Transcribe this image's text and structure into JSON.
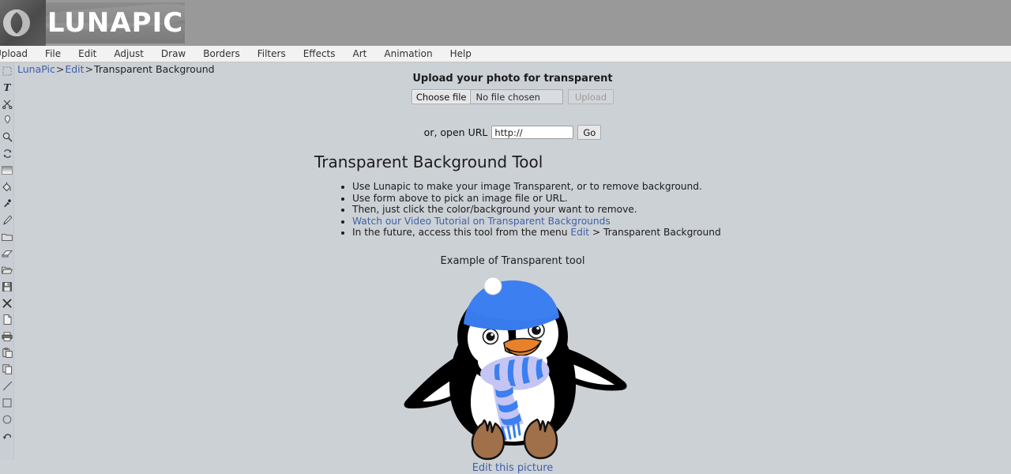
{
  "header": {
    "logo_text": "LUNAPIC",
    "logo_icon": "crescent-moon-icon"
  },
  "menubar": {
    "items": [
      {
        "label": "Upload"
      },
      {
        "label": "File"
      },
      {
        "label": "Edit"
      },
      {
        "label": "Adjust"
      },
      {
        "label": "Draw"
      },
      {
        "label": "Borders"
      },
      {
        "label": "Filters"
      },
      {
        "label": "Effects"
      },
      {
        "label": "Art"
      },
      {
        "label": "Animation"
      },
      {
        "label": "Help"
      }
    ]
  },
  "breadcrumb": {
    "home": "LunaPic",
    "sep1": ">",
    "section": "Edit",
    "sep2": ">",
    "current": "Transparent Background"
  },
  "sidebar": {
    "tools": [
      {
        "name": "marquee-select-icon",
        "title": "Select"
      },
      {
        "name": "text-icon",
        "title": "Text"
      },
      {
        "name": "scissors-icon",
        "title": "Cut"
      },
      {
        "name": "eraser-small-icon",
        "title": "Erase"
      },
      {
        "name": "magnifier-icon",
        "title": "Zoom"
      },
      {
        "name": "rotate-refresh-icon",
        "title": "Rotate"
      },
      {
        "name": "gradient-bar-icon",
        "title": "Gradient"
      },
      {
        "name": "paint-bucket-icon",
        "title": "Fill"
      },
      {
        "name": "eyedropper-icon",
        "title": "Color Picker"
      },
      {
        "name": "pencil-icon",
        "title": "Pencil"
      },
      {
        "name": "folder-icon",
        "title": "Folder"
      },
      {
        "name": "eraser-icon",
        "title": "Eraser"
      },
      {
        "name": "open-folder-icon",
        "title": "Open"
      },
      {
        "name": "save-floppy-icon",
        "title": "Save"
      },
      {
        "name": "close-x-icon",
        "title": "Close"
      },
      {
        "name": "new-document-icon",
        "title": "New"
      },
      {
        "name": "printer-icon",
        "title": "Print"
      },
      {
        "name": "paste-icon",
        "title": "Paste"
      },
      {
        "name": "copy-icon",
        "title": "Copy"
      },
      {
        "name": "line-icon",
        "title": "Line"
      },
      {
        "name": "rectangle-icon",
        "title": "Rectangle"
      },
      {
        "name": "ellipse-icon",
        "title": "Ellipse"
      },
      {
        "name": "undo-arrow-icon",
        "title": "Undo"
      }
    ]
  },
  "upload": {
    "title": "Upload your photo for transparent",
    "choose_file_label": "Choose file",
    "file_status": "No file chosen",
    "upload_button_label": "Upload",
    "url_label": "or, open URL",
    "url_value": "http://",
    "url_placeholder": "http://",
    "go_button_label": "Go"
  },
  "tool": {
    "heading": "Transparent Background Tool",
    "bullets": [
      {
        "text": "Use Lunapic to make your image Transparent, or to remove background.",
        "link": null,
        "after": null
      },
      {
        "text": "Use form above to pick an image file or URL.",
        "link": null,
        "after": null
      },
      {
        "text": "Then, just click the color/background your want to remove.",
        "link": null,
        "after": null
      },
      {
        "text": "",
        "link": "Watch our Video Tutorial on Transparent Backgrounds",
        "after": ""
      },
      {
        "text": "In the future, access this tool from the menu ",
        "link": "Edit",
        "after": " > Transparent Background"
      }
    ]
  },
  "example": {
    "caption": "Example of Transparent tool",
    "image_alt": "penguin-illustration",
    "edit_link_label": "Edit this picture"
  },
  "colors": {
    "header_gray": "#999999",
    "page_background": "#ccd1d6",
    "menubar_background": "#f2f2f2",
    "link_blue": "#3f5fa6",
    "hat_blue": "#3b7ff0",
    "scarf_light": "#c5c5f5",
    "scarf_stripe": "#3b7ff0",
    "beak_orange": "#e8822a",
    "feet_brown": "#a0704a",
    "body_black": "#000000",
    "body_white": "#ffffff"
  }
}
